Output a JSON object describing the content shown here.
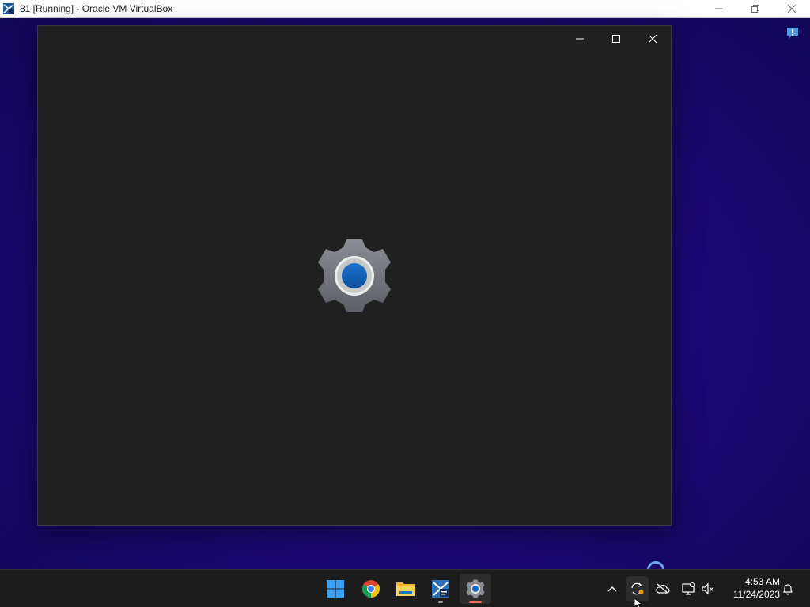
{
  "host": {
    "title": "81 [Running] - Oracle VM VirtualBox",
    "controls": [
      "minimize",
      "restore",
      "close"
    ]
  },
  "desktop": {
    "feedback_icon": "feedback-hub-icon"
  },
  "settings_window": {
    "splash_icon": "settings-gear-icon",
    "controls": [
      "minimize",
      "maximize",
      "close"
    ]
  },
  "taskbar": {
    "apps": [
      {
        "name": "Start",
        "icon": "windows-start-icon"
      },
      {
        "name": "Google Chrome",
        "icon": "chrome-icon"
      },
      {
        "name": "File Explorer",
        "icon": "folder-icon"
      },
      {
        "name": "Oracle VM VirtualBox",
        "icon": "virtualbox-icon",
        "running": true
      },
      {
        "name": "Settings",
        "icon": "settings-icon",
        "active": true
      }
    ],
    "tray": [
      "chevron-up-icon",
      "sync-icon",
      "onedrive-icon",
      "network-icon",
      "volume-muted-icon",
      "notification-bell-icon"
    ],
    "clock": {
      "time": "4:53 AM",
      "date": "11/24/2023"
    }
  },
  "colors": {
    "accent": "#0067c0",
    "desktop": "#1c0878",
    "window": "#202020",
    "taskbar": "#1c1c1c"
  }
}
